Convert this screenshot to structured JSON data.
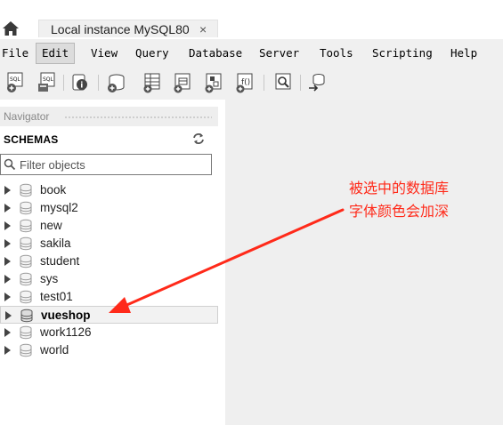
{
  "tab": {
    "title": "Local instance MySQL80",
    "close": "×"
  },
  "menu": {
    "items": [
      "File",
      "Edit",
      "View",
      "Query",
      "Database",
      "Server",
      "Tools",
      "Scripting",
      "Help"
    ],
    "active": "Edit"
  },
  "toolbar": {
    "icons": [
      "new-sql-tab-icon",
      "open-sql-script-icon",
      "inspector-icon",
      "create-schema-icon",
      "create-table-icon",
      "create-view-icon",
      "create-procedure-icon",
      "create-function-icon",
      "search-table-data-icon",
      "reconnect-icon"
    ]
  },
  "navigator": {
    "header": "Navigator",
    "section_title": "SCHEMAS",
    "search_placeholder": "Filter objects",
    "schemas": [
      {
        "name": "book",
        "selected": false
      },
      {
        "name": "mysql2",
        "selected": false
      },
      {
        "name": "new",
        "selected": false
      },
      {
        "name": "sakila",
        "selected": false
      },
      {
        "name": "student",
        "selected": false
      },
      {
        "name": "sys",
        "selected": false
      },
      {
        "name": "test01",
        "selected": false
      },
      {
        "name": "vueshop",
        "selected": true
      },
      {
        "name": "work1126",
        "selected": false
      },
      {
        "name": "world",
        "selected": false
      }
    ]
  },
  "annotation": {
    "line1": "被选中的数据库",
    "line2": "字体颜色会加深",
    "color": "#ff2a1a"
  },
  "colors": {
    "menu_bg": "#f0f0f0",
    "main_area_bg": "#efefef",
    "selected_row_bg": "#f2f2f2"
  }
}
